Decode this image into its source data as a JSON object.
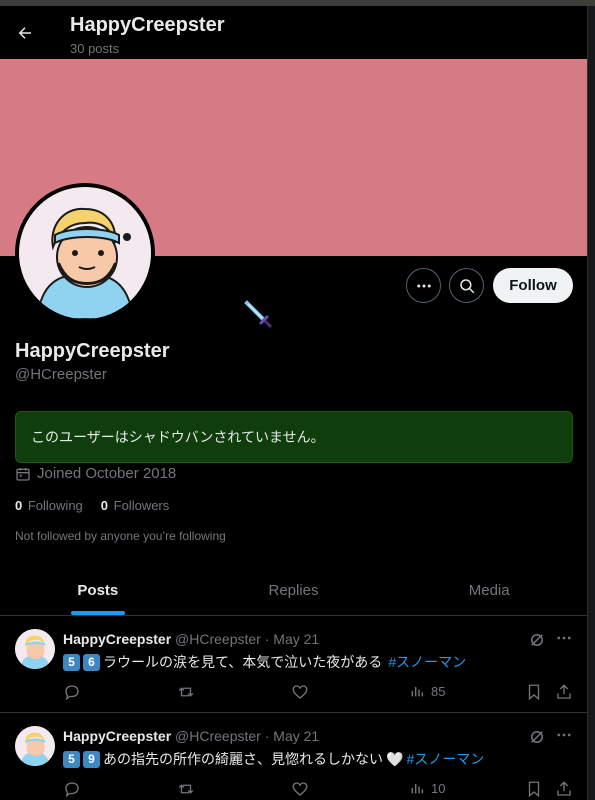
{
  "header": {
    "name": "HappyCreepster",
    "post_count": "30 posts"
  },
  "profile": {
    "display_name": "HappyCreepster",
    "handle": "@HCreepster",
    "banner_color": "#d67b83",
    "shadowban_notice": "このユーザーはシャドウバンされていません。",
    "joined": "Joined October 2018",
    "following_count": "0",
    "following_label": "Following",
    "followers_count": "0",
    "followers_label": "Followers",
    "not_followed": "Not followed by anyone you’re following"
  },
  "buttons": {
    "follow": "Follow"
  },
  "tabs": [
    {
      "label": "Posts"
    },
    {
      "label": "Replies"
    },
    {
      "label": "Media"
    }
  ],
  "posts": [
    {
      "name": "HappyCreepster",
      "handle": "@HCreepster",
      "sep": "·",
      "date": "May 21",
      "badge1": "5",
      "badge2": "6",
      "text": "ラウールの涙を見て、本気で泣いた夜がある",
      "heart": "",
      "hashtag": "#スノーマン",
      "views": "85"
    },
    {
      "name": "HappyCreepster",
      "handle": "@HCreepster",
      "sep": "·",
      "date": "May 21",
      "badge1": "5",
      "badge2": "9",
      "text": "あの指先の所作の綺麗さ、見惚れるしかない",
      "heart": "🤍",
      "hashtag": "#スノーマン",
      "views": "10"
    }
  ],
  "colors": {
    "accent": "#1d9bf0",
    "notice_bg": "#0f3e0c",
    "emoji_badge": "#3b88c3"
  }
}
